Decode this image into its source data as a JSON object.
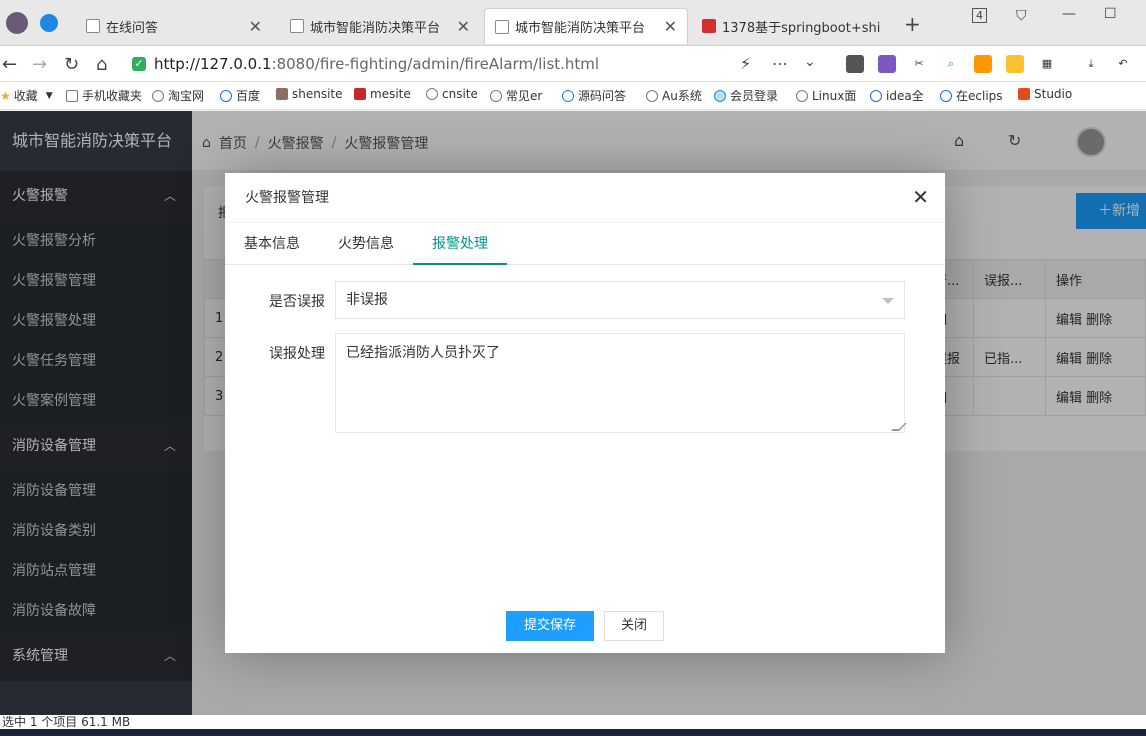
{
  "browser": {
    "tabs": [
      {
        "label": "在线问答",
        "active": false
      },
      {
        "label": "城市智能消防决策平台",
        "active": false
      },
      {
        "label": "城市智能消防决策平台",
        "active": true
      },
      {
        "label": "1378基于springboot+shi",
        "active": false
      }
    ],
    "new_tab": "+",
    "tab_count": "4",
    "url_host": "http://127.0.0.1",
    "url_rest": ":8080/fire-fighting/admin/fireAlarm/list.html",
    "bookmarks": [
      "收藏",
      "手机收藏夹",
      "淘宝网",
      "百度",
      "shensite",
      "mesite",
      "cnsite",
      "常见er",
      "源码问答",
      "Au系统",
      "会员登录",
      "Linux面",
      "idea全",
      "在eclips",
      "Studio"
    ]
  },
  "sidebar": {
    "title": "城市智能消防决策平台",
    "groups": [
      {
        "label": "火警报警",
        "items": [
          "火警报警分析",
          "火警报警管理",
          "火警报警处理",
          "火警任务管理",
          "火警案例管理"
        ]
      },
      {
        "label": "消防设备管理",
        "items": [
          "消防设备管理",
          "消防设备类别",
          "消防站点管理",
          "消防设备故障"
        ]
      },
      {
        "label": "系统管理",
        "items": []
      }
    ]
  },
  "breadcrumb": {
    "home": "首页",
    "level1": "火警报警",
    "level2": "火警报警管理"
  },
  "table": {
    "headers": [
      "",
      "",
      "",
      "",
      "",
      "",
      "",
      "",
      "",
      "否...",
      "误报...",
      "操作"
    ],
    "rows": [
      {
        "num": "1",
        "c1": "如",
        "c2": "",
        "ops": "编辑 删除"
      },
      {
        "num": "2",
        "c1": "误报",
        "c2": "已指...",
        "ops": "编辑 删除"
      },
      {
        "num": "3",
        "c1": "如",
        "c2": "",
        "ops": "编辑 删除"
      }
    ],
    "add_label": "新增",
    "search_stub": "报"
  },
  "modal": {
    "title": "火警报警管理",
    "tabs": [
      "基本信息",
      "火势信息",
      "报警处理"
    ],
    "selected_tab": "报警处理",
    "fields": {
      "is_false_label": "是否误报",
      "is_false_value": "非误报",
      "handle_label": "误报处理",
      "handle_value": "已经指派消防人员扑灭了"
    },
    "submit_label": "提交保存",
    "close_label": "关闭"
  },
  "status_bar": "选中 1 个项目  61.1 MB"
}
